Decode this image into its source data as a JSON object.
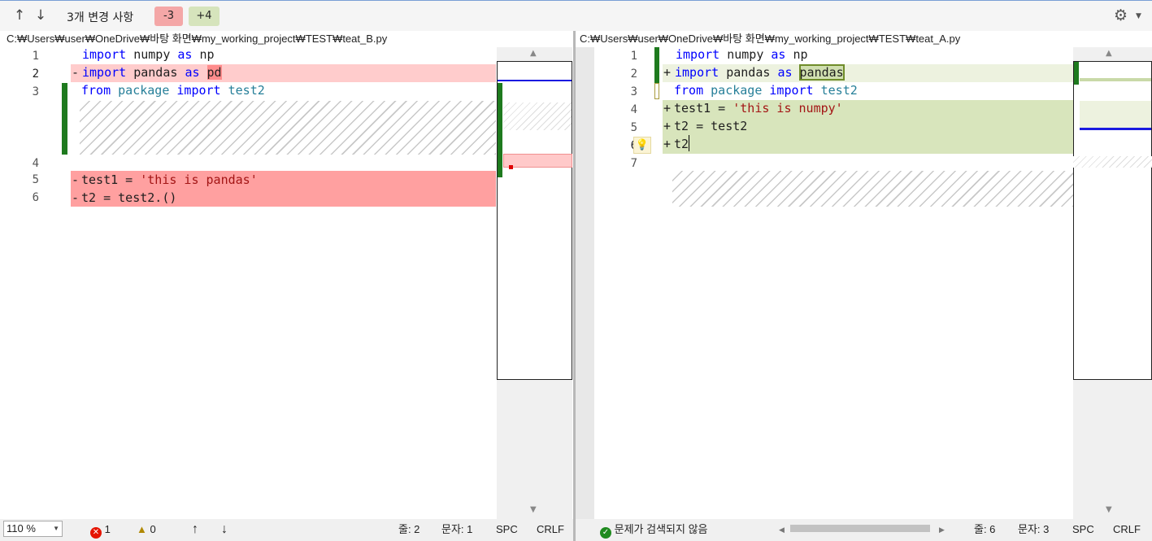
{
  "toolbar": {
    "summary": "3개 변경 사항",
    "deleted_badge": "-3",
    "added_badge": "+4",
    "up_icon": "arrow-up-icon",
    "down_icon": "arrow-down-icon",
    "settings_icon": "gear-icon"
  },
  "left": {
    "path": "C:₩Users₩user₩OneDrive₩바탕 화면₩my_working_project₩TEST₩teat_B.py",
    "line_numbers": [
      "1",
      "2",
      "3",
      "4",
      "5",
      "6"
    ],
    "lines": {
      "l1_kw": "import",
      "l1_rest": " numpy ",
      "l1_as": "as",
      "l1_np": " np",
      "l2_marker": "-",
      "l2_kw": "import",
      "l2_rest": " pandas ",
      "l2_as": "as",
      "l2_hl": "pd",
      "l3_kw1": "from",
      "l3_pkg": " package ",
      "l3_kw2": "import",
      "l3_name": " test2",
      "l5_marker": "-",
      "l5_text": "test1 = ",
      "l5_str": "'this is pandas'",
      "l6_marker": "-",
      "l6_text": "t2 = test2.()"
    },
    "status": {
      "zoom": "110 %",
      "errors": "1",
      "warnings": "0",
      "line": "줄: 2",
      "char": "문자: 1",
      "spc": "SPC",
      "eol": "CRLF"
    }
  },
  "right": {
    "path": "C:₩Users₩user₩OneDrive₩바탕 화면₩my_working_project₩TEST₩teat_A.py",
    "line_numbers": [
      "1",
      "2",
      "3",
      "4",
      "5",
      "6",
      "7"
    ],
    "lines": {
      "l1_kw": "import",
      "l1_rest": " numpy ",
      "l1_as": "as",
      "l1_np": " np",
      "l2_marker": "+",
      "l2_kw": "import",
      "l2_rest": " pandas ",
      "l2_as": "as",
      "l2_hl": "pandas",
      "l3_kw1": "from",
      "l3_pkg": " package ",
      "l3_kw2": "import",
      "l3_name": " test2",
      "l4_marker": "+",
      "l4_text": "test1 = ",
      "l4_str": "'this is numpy'",
      "l5_marker": "+",
      "l5_text": "t2 = test2",
      "l6_marker": "+",
      "l6_text": "t2"
    },
    "status": {
      "problems": "문제가 검색되지 않음",
      "line": "줄: 6",
      "char": "문자: 3",
      "spc": "SPC",
      "eol": "CRLF"
    }
  },
  "colors": {
    "deleted_bg": "#ffa0a0",
    "deleted_light_bg": "#ffcccc",
    "added_bg": "#d8e5bc",
    "added_light_bg": "#edf2df",
    "change_bar": "#1e7a1e",
    "keyword": "#0000ff",
    "string": "#a31515"
  }
}
